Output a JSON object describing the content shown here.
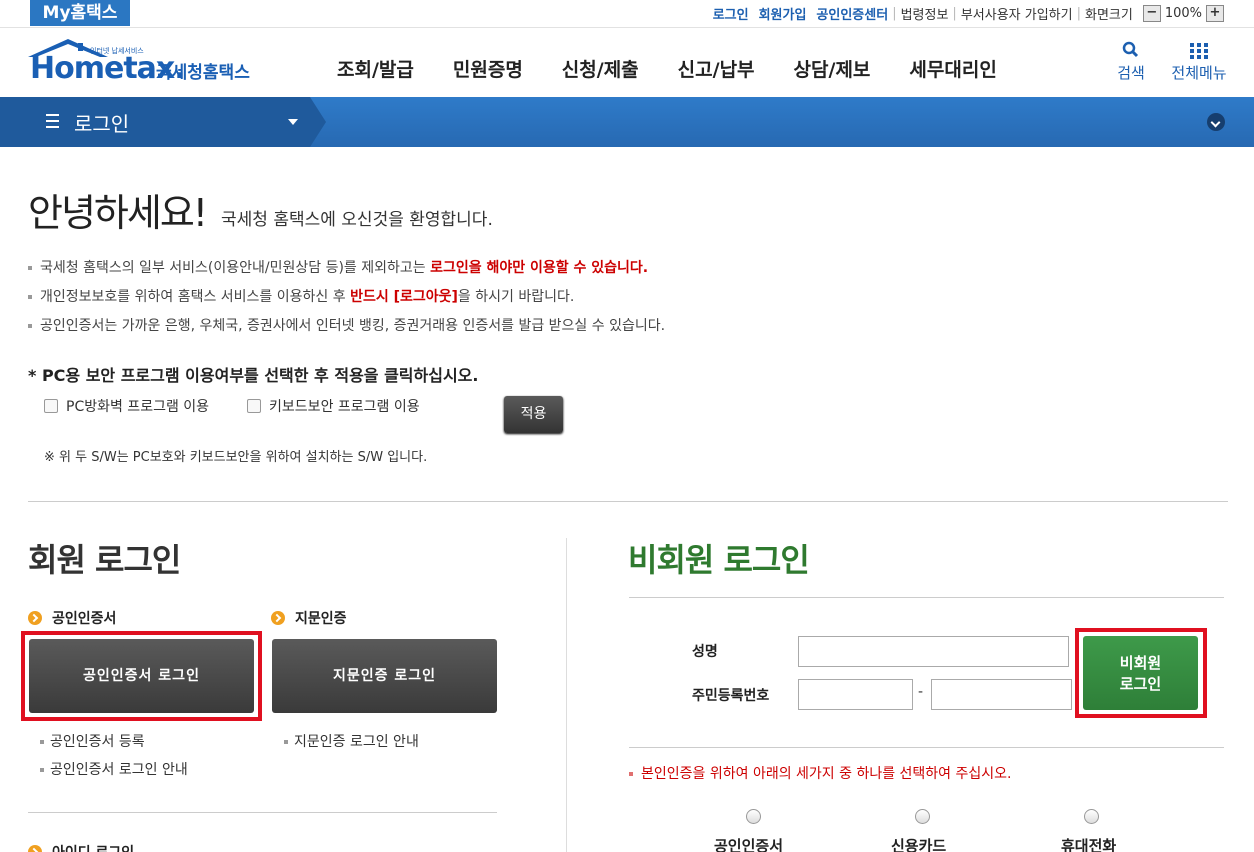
{
  "top": {
    "my_tab": "My홈택스",
    "links": [
      "로그인",
      "회원가입",
      "공인인증센터"
    ],
    "gray_links": [
      "법령정보",
      "부서사용자 가입하기",
      "화면크기"
    ],
    "zoom_minus": "−",
    "zoom_value": "100%",
    "zoom_plus": "+"
  },
  "header": {
    "logo_main": "Hometax.",
    "logo_sub": "국세청홈택스",
    "logo_small": "인터넷 납세서비스",
    "menu": [
      "조회/발급",
      "민원증명",
      "신청/제출",
      "신고/납부",
      "상담/제보",
      "세무대리인"
    ],
    "search_label": "검색",
    "allmenu_label": "전체메뉴",
    "search_icon": "search-icon",
    "allmenu_icon": "grid-icon"
  },
  "nav": {
    "title": "로그인"
  },
  "greeting": {
    "title": "안녕하세요!",
    "subtitle": "국세청 홈택스에 오신것을 환영합니다."
  },
  "notices": [
    {
      "pre": "국세청 홈택스의 일부 서비스(이용안내/민원상담 등)를 제외하고는 ",
      "red": "로그인을 해야만 이용할 수 있습니다.",
      "post": ""
    },
    {
      "pre": "개인정보보호를 위하여 홈택스 서비스를 이용하신 후 ",
      "red": "반드시 [로그아웃]",
      "post": "을 하시기 바랍니다."
    },
    {
      "pre": "공인인증서는 가까운 은행, 우체국, 증권사에서 인터넷 뱅킹, 증권거래용 인증서를 발급 받으실 수 있습니다.",
      "red": "",
      "post": ""
    }
  ],
  "security": {
    "title": "* PC용 보안 프로그램 이용여부를 선택한 후 적용을 클릭하십시오.",
    "firewall_label": "PC방화벽 프로그램 이용",
    "keyboard_label": "키보드보안 프로그램 이용",
    "apply_label": "적용",
    "note": "※ 위 두 S/W는 PC보호와 키보드보안을 위하여 설치하는 S/W 입니다."
  },
  "member": {
    "title": "회원 로그인",
    "cert_heading": "공인인증서",
    "finger_heading": "지문인증",
    "cert_button": "공인인증서 로그인",
    "finger_button": "지문인증 로그인",
    "cert_links": [
      "공인인증서 등록",
      "공인인증서 로그인 안내"
    ],
    "finger_links": [
      "지문인증 로그인 안내"
    ],
    "id_heading": "아이디 로그인"
  },
  "nonmember": {
    "title": "비회원 로그인",
    "name_label": "성명",
    "rrn_label": "주민등록번호",
    "dash": "-",
    "button_line1": "비회원",
    "button_line2": "로그인",
    "notice": "본인인증을 위하여 아래의 세가지 중 하나를 선택하여 주십시오.",
    "options": [
      "공인인증서",
      "신용카드",
      "휴대전화"
    ]
  },
  "colors": {
    "brand_blue": "#2b77c2",
    "nav_blue": "#2f7bc9",
    "green": "#2f7a2f",
    "highlight_red": "#e01020"
  }
}
